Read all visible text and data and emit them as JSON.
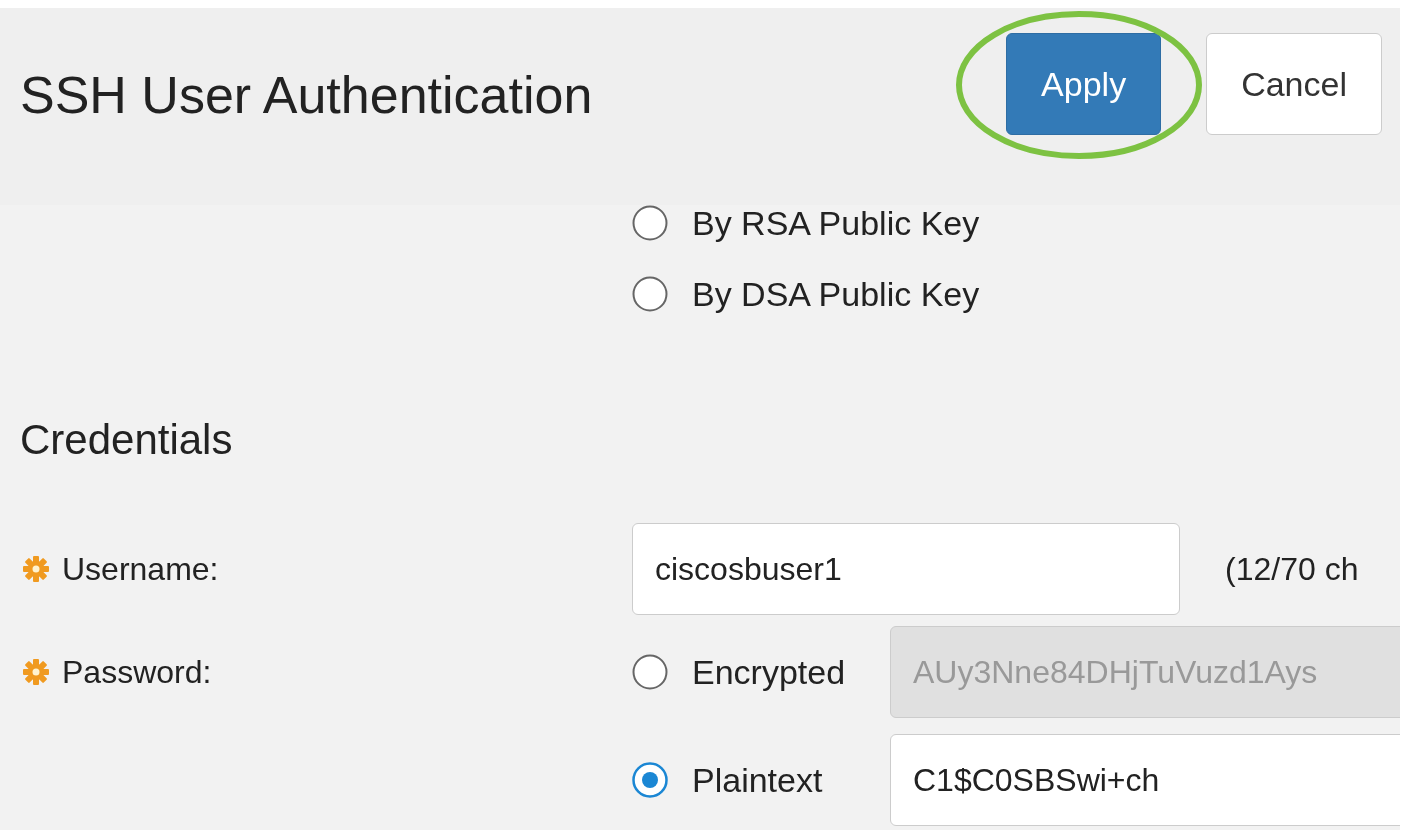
{
  "title": "SSH User Authentication",
  "buttons": [
    {
      "label": "Apply",
      "kind": "primary",
      "highlighted": true
    },
    {
      "label": "Cancel",
      "kind": "secondary",
      "highlighted": false
    }
  ],
  "key_options": [
    {
      "label": "By RSA Public Key",
      "selected": false
    },
    {
      "label": "By DSA Public Key",
      "selected": false
    }
  ],
  "credentials": {
    "heading": "Credentials",
    "username": {
      "label": "Username:",
      "required": true,
      "value": "ciscosbuser1",
      "note": "(12/70 ch"
    },
    "password": {
      "label": "Password:",
      "required": true,
      "options": [
        {
          "label": "Encrypted",
          "selected": false,
          "value": "AUy3Nne84DHjTuVuzd1Ays"
        },
        {
          "label": "Plaintext",
          "selected": true,
          "value": "C1$C0SBSwi+ch"
        }
      ]
    }
  }
}
